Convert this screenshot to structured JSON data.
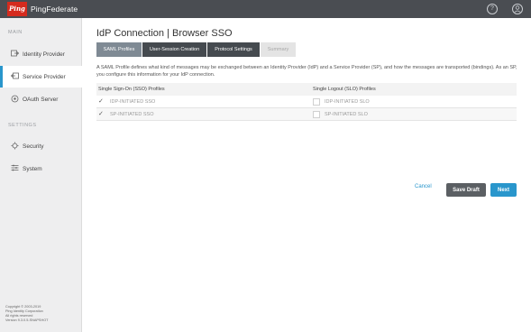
{
  "header": {
    "logo_mark": "Ping",
    "logo_text": "PingFederate",
    "help_icon": "?",
    "user_icon": "user-icon"
  },
  "sidebar": {
    "sections": [
      "MAIN",
      "SETTINGS"
    ],
    "items": [
      {
        "label": "Identity Provider",
        "icon": "identity-provider-icon",
        "active": false
      },
      {
        "label": "Service Provider",
        "icon": "service-provider-icon",
        "active": true
      },
      {
        "label": "OAuth Server",
        "icon": "oauth-server-icon",
        "active": false
      },
      {
        "label": "Security",
        "icon": "security-icon",
        "active": false
      },
      {
        "label": "System",
        "icon": "system-icon",
        "active": false
      }
    ],
    "footer": [
      "Copyright © 2003-2019",
      "Ping Identity Corporation",
      "All rights reserved",
      "Version 9.3.0.5-SNAPSHOT"
    ]
  },
  "main": {
    "title": "IdP Connection | Browser SSO",
    "tabs": [
      {
        "label": "SAML Profiles",
        "state": "current"
      },
      {
        "label": "User-Session Creation",
        "state": "enabled"
      },
      {
        "label": "Protocol Settings",
        "state": "enabled"
      },
      {
        "label": "Summary",
        "state": "disabled"
      }
    ],
    "description": "A SAML Profile defines what kind of messages may be exchanged between an Identity Provider (IdP) and a Service Provider (SP), and how the messages are transported (bindings). As an SP, you configure this information for your IdP connection.",
    "table": {
      "headers": [
        "Single Sign-On (SSO) Profiles",
        "Single Logout (SLO) Profiles"
      ],
      "rows": [
        {
          "sso_label": "IDP-INITIATED SSO",
          "sso_checked": true,
          "slo_label": "IDP-INITIATED SLO",
          "slo_checked": false
        },
        {
          "sso_label": "SP-INITIATED SSO",
          "sso_checked": true,
          "slo_label": "SP-INITIATED SLO",
          "slo_checked": false
        }
      ]
    },
    "actions": {
      "cancel": "Cancel",
      "save_draft": "Save Draft",
      "next": "Next"
    }
  },
  "colors": {
    "topbar": "#4a4d52",
    "accent": "#2996cc",
    "brand_red": "#d52b1e"
  }
}
